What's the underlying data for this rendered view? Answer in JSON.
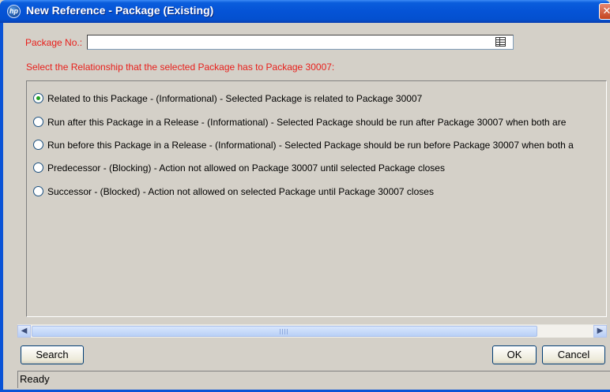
{
  "window": {
    "title": "New Reference - Package (Existing)",
    "app_icon_text": "hp",
    "close_glyph": "✕"
  },
  "form": {
    "package_label": "Package No.:",
    "package_value": "",
    "lookup_icon": "table-lookup-icon",
    "relationship_prompt": "Select the Relationship that the selected Package has to Package 30007:"
  },
  "relationships": [
    {
      "label": "Related to this Package - (Informational) - Selected Package is related to Package 30007",
      "checked": true
    },
    {
      "label": "Run after this Package in a Release - (Informational) - Selected Package should be run after Package 30007 when both are",
      "checked": false
    },
    {
      "label": "Run before this Package in a Release - (Informational) - Selected Package should be run before Package 30007 when both a",
      "checked": false
    },
    {
      "label": "Predecessor - (Blocking) - Action not allowed on Package 30007 until selected Package closes",
      "checked": false
    },
    {
      "label": "Successor - (Blocked) - Action not allowed on selected Package until Package 30007 closes",
      "checked": false
    }
  ],
  "buttons": {
    "search": "Search",
    "ok": "OK",
    "cancel": "Cancel"
  },
  "status": "Ready",
  "colors": {
    "label_red": "#e8201c",
    "titlebar_blue": "#0553d6",
    "radio_selected": "#21a121"
  }
}
